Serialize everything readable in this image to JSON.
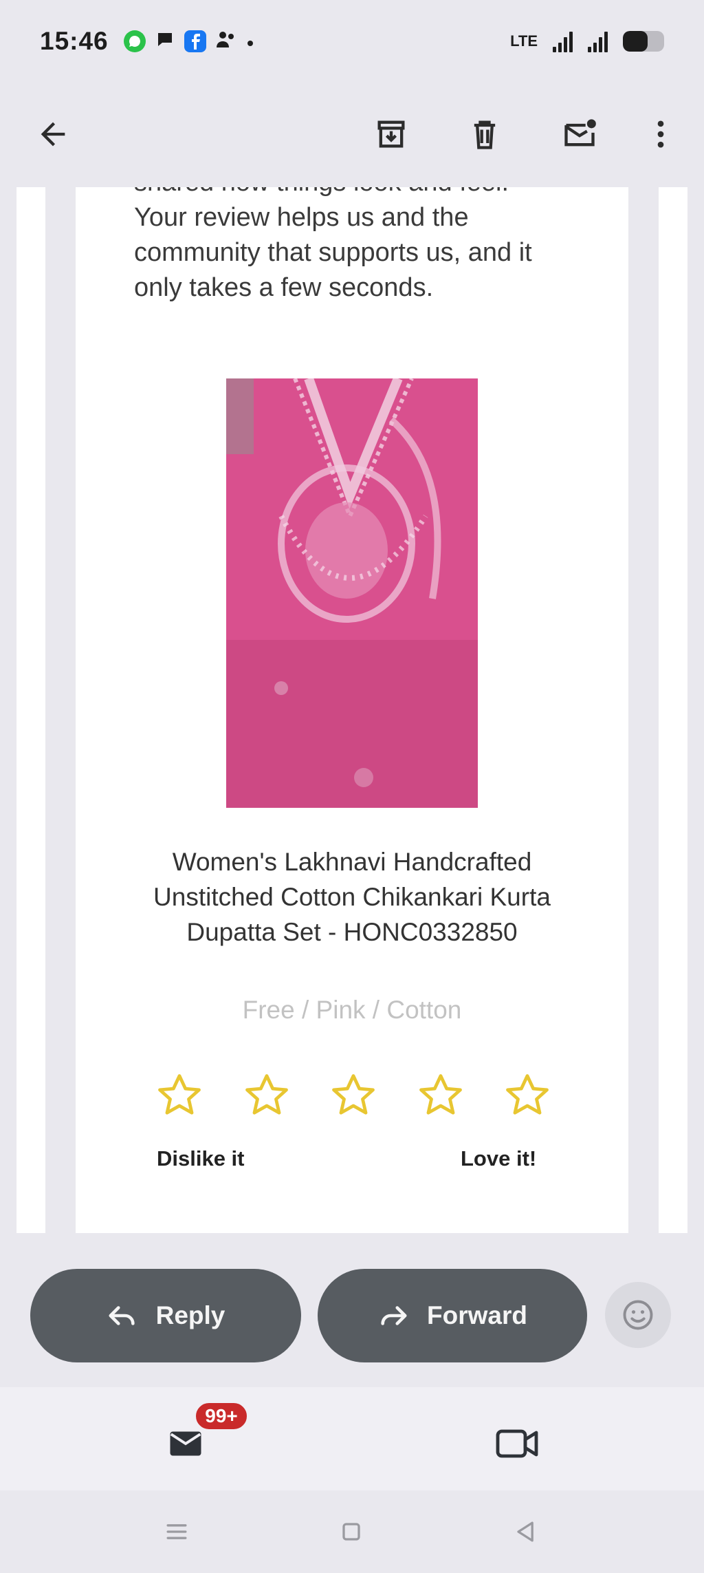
{
  "status_bar": {
    "time": "15:46",
    "left_icons": [
      "whatsapp-icon",
      "chat-bubble-icon",
      "facebook-icon",
      "people-icon",
      "dot-icon"
    ],
    "right_icons": [
      "volte-icon",
      "signal-icon",
      "signal-icon",
      "battery-icon"
    ],
    "volte_label": "LTE"
  },
  "toolbar": {
    "back_icon": "arrow-left-icon",
    "archive_icon": "archive-icon",
    "delete_icon": "trash-icon",
    "unread_icon": "mark-unread-icon",
    "more_icon": "more-vert-icon"
  },
  "email": {
    "intro_line_partial": "shared how things look and feel.",
    "intro_text": "Your review helps us and the community that supports us, and it only takes a few seconds.",
    "product": {
      "title": "Women's Lakhnavi Handcrafted Unstitched Cotton Chikankari Kurta Dupatta Set - HONC0332850",
      "variant": "Free / Pink / Cotton",
      "image_color": "#d9508e"
    },
    "rating": {
      "stars": 5,
      "star_color": "#e8c631",
      "low_label": "Dislike it",
      "high_label": "Love it!"
    }
  },
  "actions": {
    "reply_label": "Reply",
    "forward_label": "Forward",
    "emoji_icon": "add-reaction-icon"
  },
  "bottom_nav": {
    "mail_icon": "mail-icon",
    "mail_badge": "99+",
    "meet_icon": "video-camera-icon"
  },
  "system_nav": {
    "buttons": [
      "menu-icon",
      "home-square-icon",
      "back-triangle-icon"
    ]
  },
  "colors": {
    "background": "#e9e8ee",
    "pill": "#575c61",
    "badge": "#c92a2a",
    "star": "#e8c631"
  }
}
